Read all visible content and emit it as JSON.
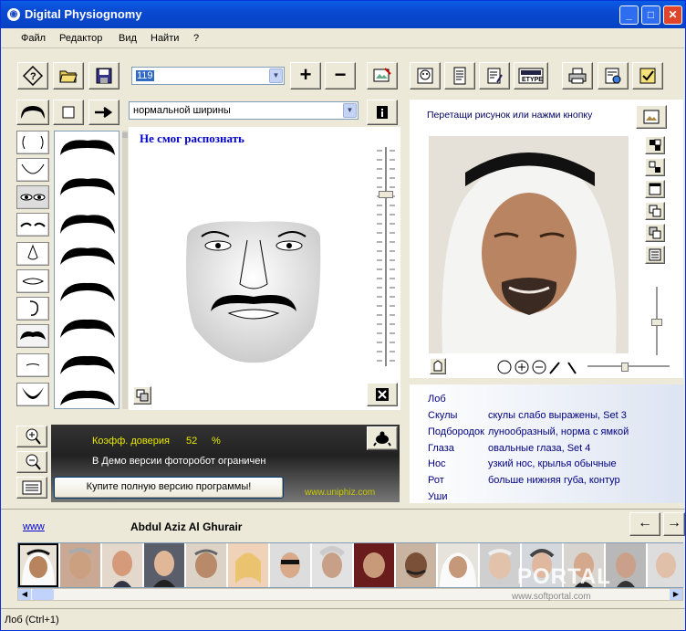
{
  "window": {
    "title": "Digital Physiognomy",
    "min": "_",
    "max": "□",
    "close": "✕"
  },
  "menu": [
    "Файл",
    "Редактор",
    "Вид",
    "Найти",
    "?"
  ],
  "toolbar": {
    "number_value": "119",
    "plus": "+",
    "minus": "−"
  },
  "shape_combo": "нормальной ширины",
  "status_recog": "Не смог распознать",
  "confidence": {
    "label": "Коэфф. доверия",
    "value": "52",
    "unit": "%"
  },
  "demo_note": "В Демо версии фоторобот ограничен",
  "buy_button": "Купите полную версию программы!",
  "site_overlay": "www.uniphiz.com",
  "drag_hint": "Перетащи рисунок или нажми кнопку",
  "features": [
    {
      "name": "Лоб",
      "value": ""
    },
    {
      "name": "Скулы",
      "value": "скулы слабо выражены, Set  3"
    },
    {
      "name": "Подбородок",
      "value": "лунообразный, норма с ямкой"
    },
    {
      "name": "Глаза",
      "value": "овальные глаза, Set  4"
    },
    {
      "name": "Нос",
      "value": "узкий нос, крылья обычные"
    },
    {
      "name": "Рот",
      "value": "больше нижняя губа, контур"
    },
    {
      "name": "Уши",
      "value": ""
    }
  ],
  "www_link": "www",
  "person_name": "Abdul Aziz Al Ghurair",
  "nav": {
    "back": "←",
    "forward": "→"
  },
  "watermark_main": "PORTAL",
  "watermark_url": "www.softportal.com",
  "statusbar": "Лоб (Ctrl+1)",
  "colors": {
    "title_blue": "#0a49d1",
    "recog_blue": "#0000cc",
    "conf_yellow": "#e8e800",
    "panel_dark": "#1a1a1a"
  }
}
